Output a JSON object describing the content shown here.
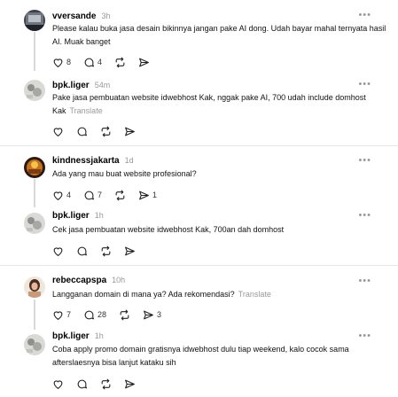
{
  "threads": [
    {
      "root": {
        "username": "vversande",
        "time": "3h",
        "text": "Please kalau buka jasa desain bikinnya jangan pake AI dong. Udah bayar mahal ternyata hasil AI. Muak banget",
        "translate": "",
        "likes": "8",
        "comments": "4",
        "shares": ""
      },
      "reply": {
        "username": "bpk.liger",
        "time": "54m",
        "text": "Pake jasa pembuatan website idwebhost Kak, nggak pake AI, 700 udah include domhost Kak",
        "translate": "Translate",
        "likes": "",
        "comments": "",
        "shares": ""
      }
    },
    {
      "root": {
        "username": "kindnessjakarta",
        "time": "1d",
        "text": "Ada yang mau buat website profesional?",
        "translate": "",
        "likes": "4",
        "comments": "7",
        "shares": "1"
      },
      "reply": {
        "username": "bpk.liger",
        "time": "1h",
        "text": "Cek jasa pembuatan website idwebhost Kak, 700an dah domhost",
        "translate": "",
        "likes": "",
        "comments": "",
        "shares": ""
      }
    },
    {
      "root": {
        "username": "rebeccapspa",
        "time": "10h",
        "text": "Langganan domain di mana ya? Ada rekomendasi?",
        "translate": "Translate",
        "likes": "7",
        "comments": "28",
        "shares": "3"
      },
      "reply": {
        "username": "bpk.liger",
        "time": "1h",
        "text": "Coba apply promo domain gratisnya idwebhost dulu tiap weekend, kalo cocok sama afterslaesnya bisa lanjut kataku sih",
        "translate": "",
        "likes": "",
        "comments": "",
        "shares": ""
      }
    }
  ],
  "icons": {
    "more": "more-dots-icon",
    "like": "heart-icon",
    "comment": "comment-icon",
    "repost": "repost-icon",
    "share": "send-icon"
  },
  "colors": {
    "muted": "#999999",
    "divider": "#e6e6e6",
    "thread_line": "#d9d9d9"
  }
}
